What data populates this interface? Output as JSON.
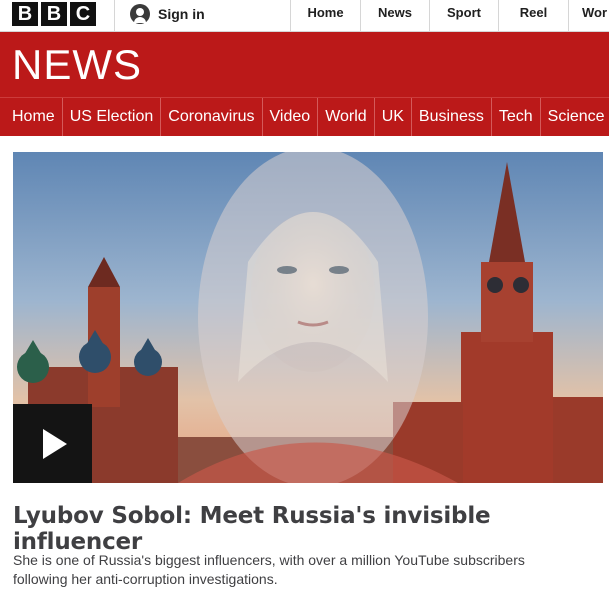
{
  "bbc_logo": [
    "B",
    "B",
    "C"
  ],
  "account": {
    "signin_label": "Sign in",
    "icon": "user-icon"
  },
  "global_nav": [
    "Home",
    "News",
    "Sport",
    "Reel",
    "Wor"
  ],
  "masthead": {
    "brand": "NEWS",
    "color": "#bb1919"
  },
  "news_nav": [
    "Home",
    "US Election",
    "Coronavirus",
    "Video",
    "World",
    "UK",
    "Business",
    "Tech",
    "Science"
  ],
  "story": {
    "headline": "Lyubov Sobol: Meet Russia's invisible influencer",
    "summary": "She is one of Russia's biggest influencers, with over a million YouTube subscribers following her anti-corruption investigations.",
    "media_icon": "play-icon"
  }
}
